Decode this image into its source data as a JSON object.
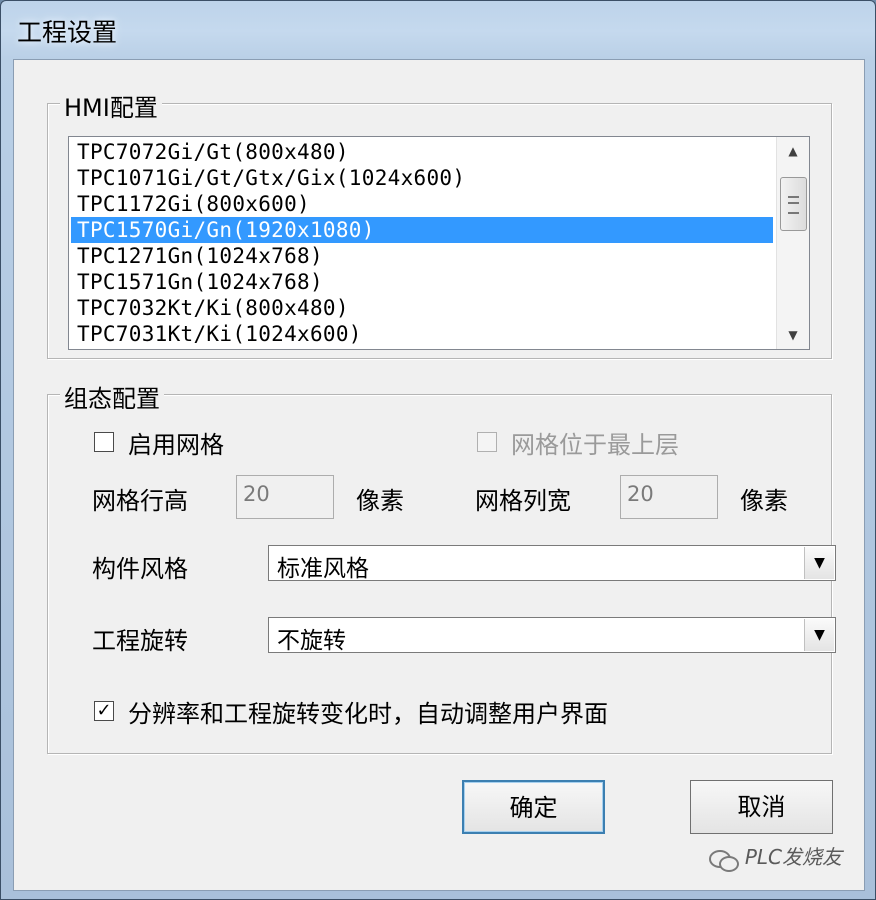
{
  "window": {
    "title": "工程设置"
  },
  "hmi_group": {
    "title": "HMI配置",
    "items": [
      "TPC7072Gi/Gt(800x480)",
      "TPC1071Gi/Gt/Gtx/Gix(1024x600)",
      "TPC1172Gi(800x600)",
      "TPC1570Gi/Gn(1920x1080)",
      "TPC1271Gn(1024x768)",
      "TPC1571Gn(1024x768)",
      "TPC7032Kt/Ki(800x480)",
      "TPC7031Kt/Ki(1024x600)"
    ],
    "selected_index": 3
  },
  "config_group": {
    "title": "组态配置",
    "enable_grid": {
      "label": "启用网格",
      "checked": false
    },
    "grid_on_top": {
      "label": "网格位于最上层",
      "checked": false,
      "enabled": false
    },
    "grid_row_height": {
      "label": "网格行高",
      "value": "20",
      "unit": "像素"
    },
    "grid_col_width": {
      "label": "网格列宽",
      "value": "20",
      "unit": "像素"
    },
    "component_style": {
      "label": "构件风格",
      "value": "标准风格"
    },
    "project_rotation": {
      "label": "工程旋转",
      "value": "不旋转"
    },
    "auto_adjust": {
      "label": "分辨率和工程旋转变化时，自动调整用户界面",
      "checked": true
    }
  },
  "buttons": {
    "ok": "确定",
    "cancel": "取消"
  },
  "watermark": {
    "text": "PLC发烧友"
  },
  "icons": {
    "check_mark": "✓",
    "combo_arrow": "▼",
    "scroll_up": "▲",
    "scroll_down": "▼"
  }
}
